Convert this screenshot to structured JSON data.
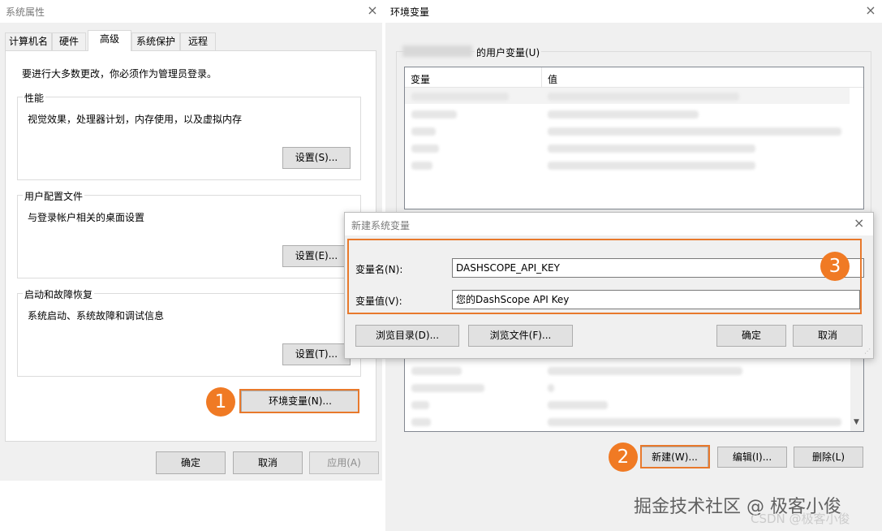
{
  "sys_props": {
    "title": "系统属性",
    "close": "×",
    "tabs": [
      "计算机名",
      "硬件",
      "高级",
      "系统保护",
      "远程"
    ],
    "admin_note": "要进行大多数更改，你必须作为管理员登录。",
    "performance": {
      "label": "性能",
      "desc": "视觉效果，处理器计划，内存使用，以及虚拟内存",
      "btn": "设置(S)..."
    },
    "profile": {
      "label": "用户配置文件",
      "desc": "与登录帐户相关的桌面设置",
      "btn": "设置(E)..."
    },
    "startup": {
      "label": "启动和故障恢复",
      "desc": "系统启动、系统故障和调试信息",
      "btn": "设置(T)..."
    },
    "env_btn": "环境变量(N)...",
    "ok": "确定",
    "cancel": "取消",
    "apply": "应用(A)"
  },
  "env_vars": {
    "title": "环境变量",
    "close": "×",
    "user_group": "的用户变量(U)",
    "col_var": "变量",
    "col_val": "值",
    "new_btn": "新建(W)...",
    "edit_btn": "编辑(I)...",
    "delete_btn": "删除(L)"
  },
  "new_sys_var": {
    "title": "新建系统变量",
    "close": "×",
    "name_label": "变量名(N):",
    "name_value": "DASHSCOPE_API_KEY",
    "value_label": "变量值(V):",
    "value_value": "您的DashScope API Key",
    "browse_dir": "浏览目录(D)...",
    "browse_file": "浏览文件(F)...",
    "ok": "确定",
    "cancel": "取消"
  },
  "badges": [
    "1",
    "2",
    "3"
  ],
  "watermark": {
    "main": "掘金技术社区 @ 极客小俊",
    "sub": "CSDN @极客小俊"
  },
  "colors": {
    "highlight": "#e8792c",
    "badge": "#f07a24"
  }
}
